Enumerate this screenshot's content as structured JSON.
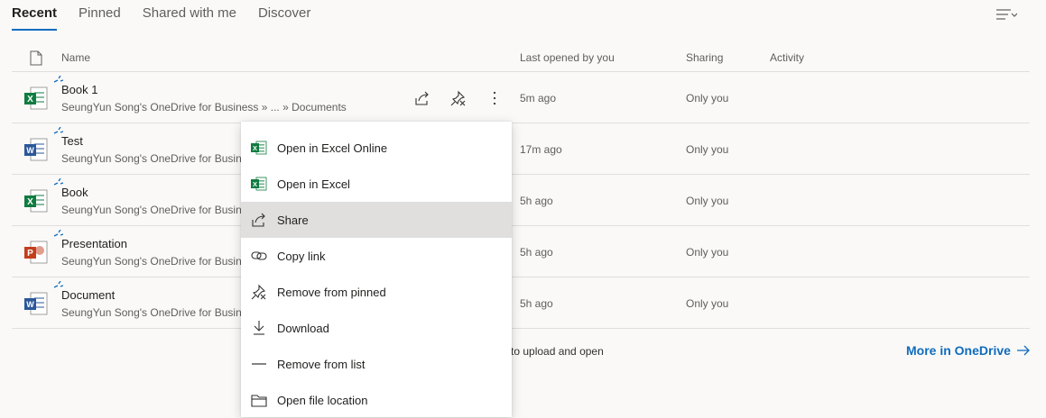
{
  "tabs": [
    "Recent",
    "Pinned",
    "Shared with me",
    "Discover"
  ],
  "columns": {
    "name": "Name",
    "last_opened": "Last opened by you",
    "sharing": "Sharing",
    "activity": "Activity"
  },
  "files": [
    {
      "name": "Book 1",
      "path": "SeungYun Song's OneDrive for Business » ... » Documents",
      "opened": "5m ago",
      "sharing": "Only you",
      "type": "excel"
    },
    {
      "name": "Test",
      "path": "SeungYun Song's OneDrive for Business",
      "opened": "17m ago",
      "sharing": "Only you",
      "type": "word"
    },
    {
      "name": "Book",
      "path": "SeungYun Song's OneDrive for Business",
      "opened": "5h ago",
      "sharing": "Only you",
      "type": "excel"
    },
    {
      "name": "Presentation",
      "path": "SeungYun Song's OneDrive for Business",
      "opened": "5h ago",
      "sharing": "Only you",
      "type": "powerpoint"
    },
    {
      "name": "Document",
      "path": "SeungYun Song's OneDrive for Business",
      "opened": "5h ago",
      "sharing": "Only you",
      "type": "word"
    }
  ],
  "footer": {
    "upload_text": "to upload and open",
    "more_link": "More in OneDrive"
  },
  "context_menu": {
    "items": [
      {
        "label": "Open in Excel Online",
        "icon": "excel-icon"
      },
      {
        "label": "Open in Excel",
        "icon": "excel-icon"
      },
      {
        "label": "Share",
        "icon": "share-icon"
      },
      {
        "label": "Copy link",
        "icon": "link-icon"
      },
      {
        "label": "Remove from pinned",
        "icon": "unpin-icon"
      },
      {
        "label": "Download",
        "icon": "download-icon"
      },
      {
        "label": "Remove from list",
        "icon": "remove-icon"
      },
      {
        "label": "Open file location",
        "icon": "folder-icon"
      }
    ],
    "highlighted": "Share"
  },
  "colors": {
    "accent": "#0f6cbd",
    "excel": "#107c41",
    "word": "#2b579a",
    "powerpoint": "#c43e1c",
    "new_marker": "#0f6cbd"
  }
}
